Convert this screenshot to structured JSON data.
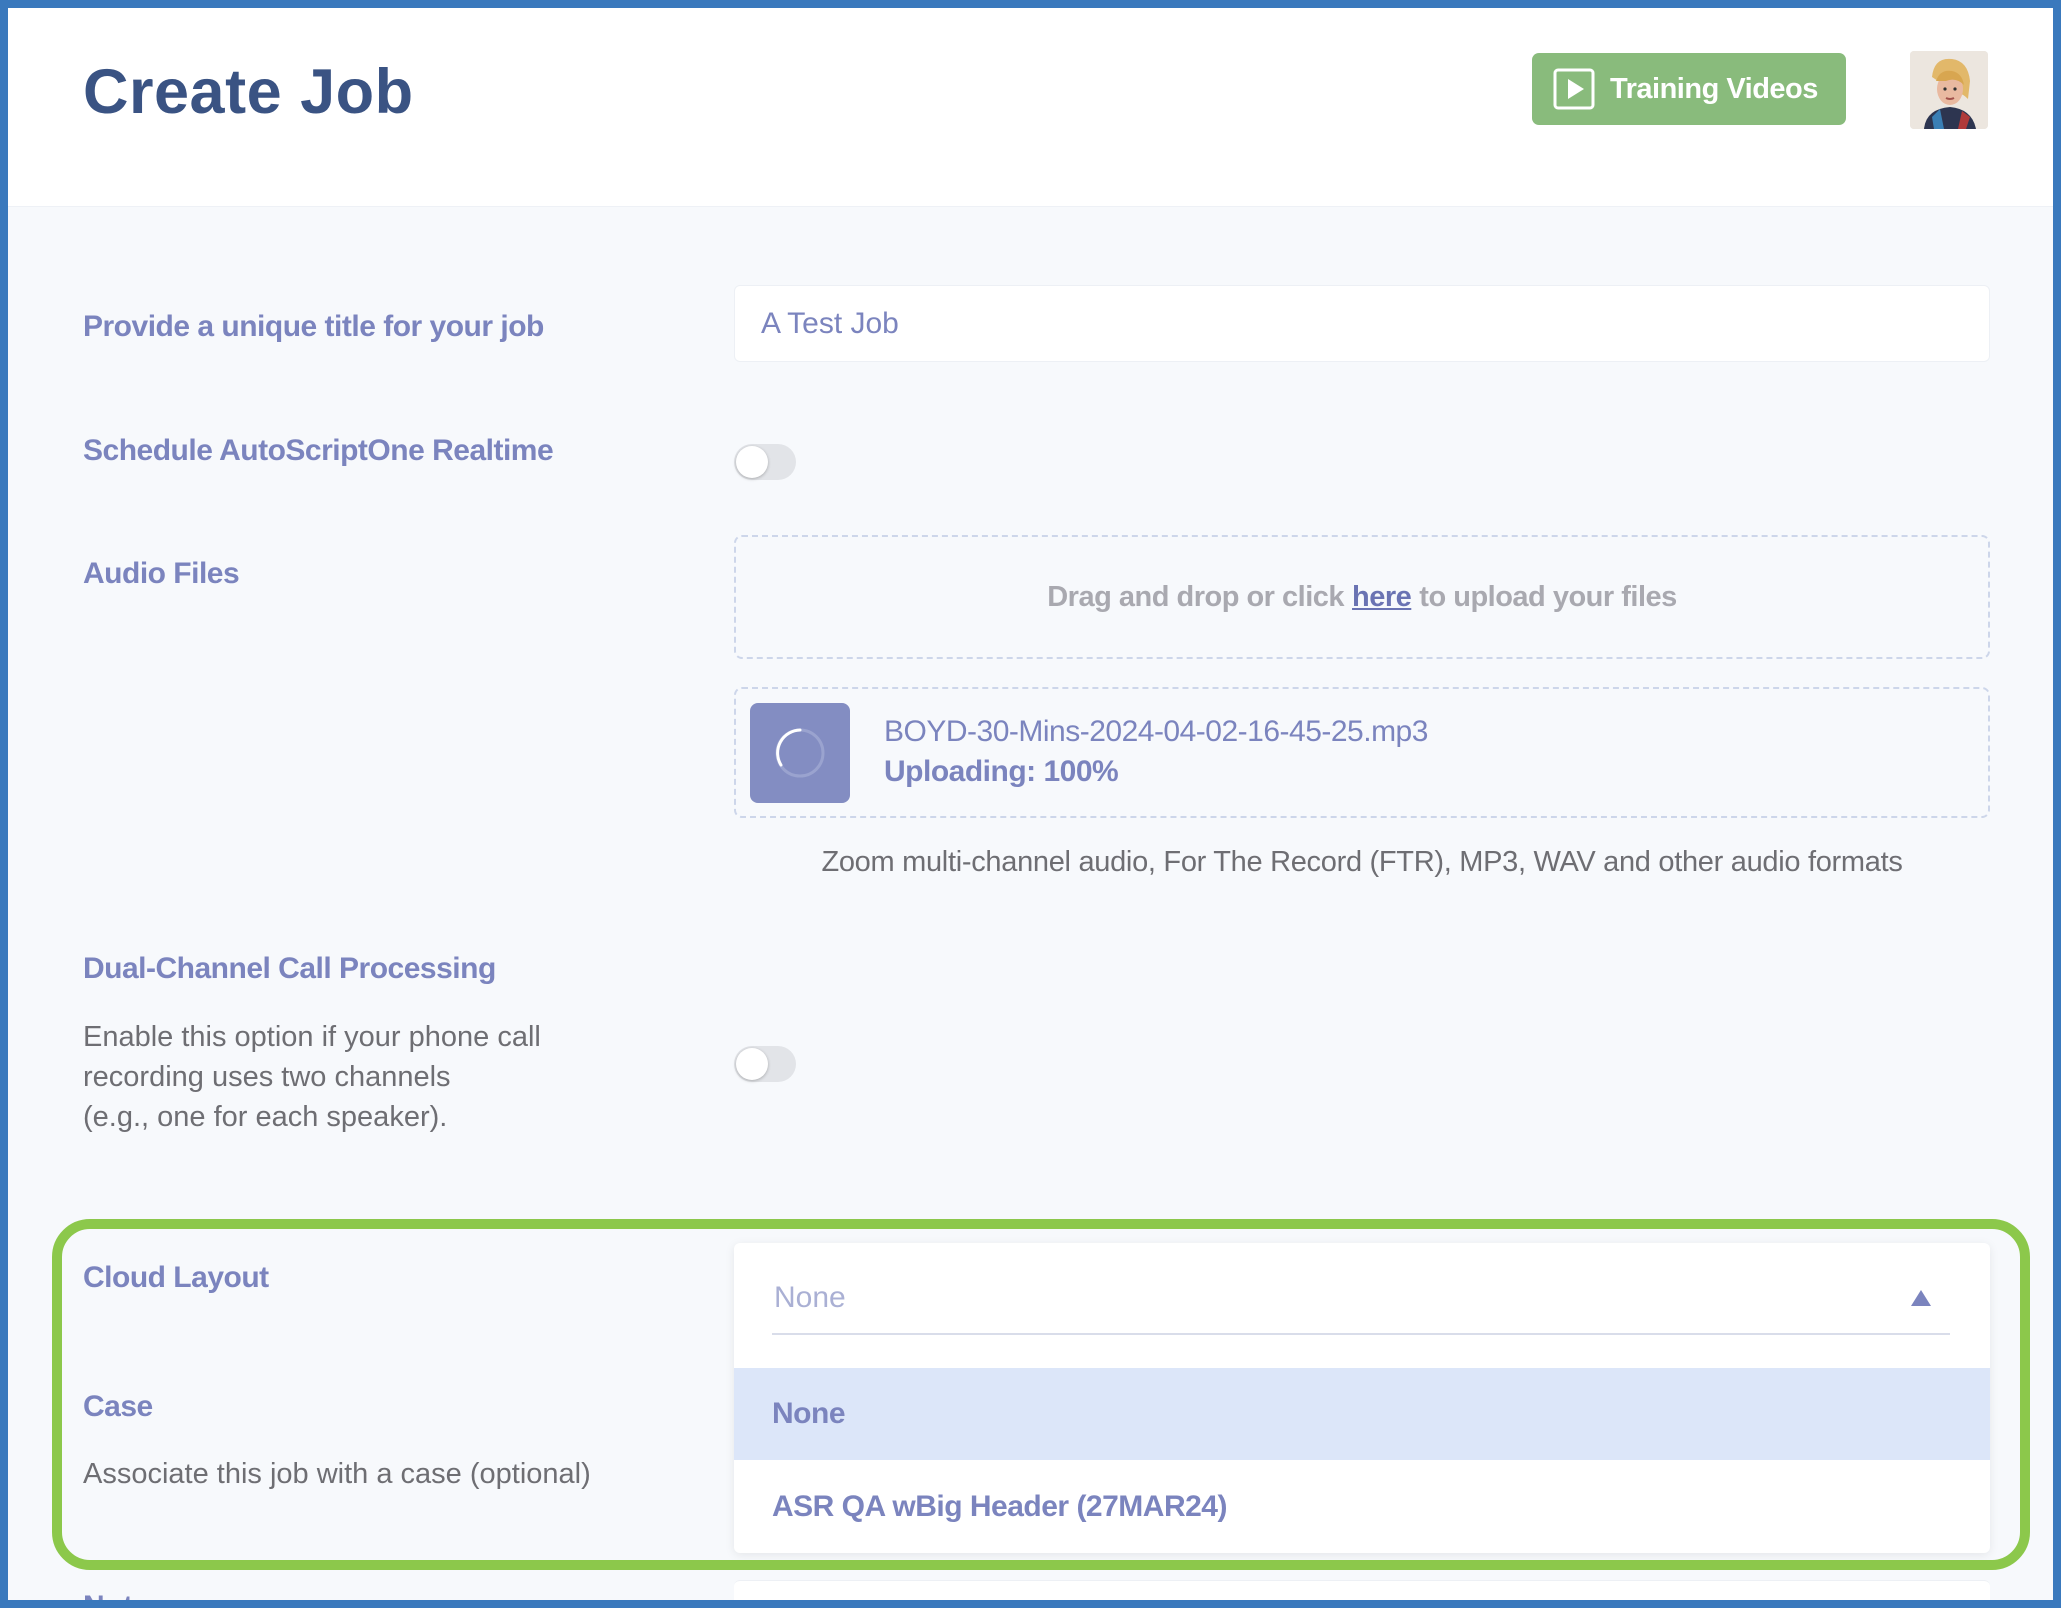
{
  "header": {
    "title": "Create Job",
    "training_label": "Training Videos",
    "training_color": "#89bb7c"
  },
  "form": {
    "title_label": "Provide a unique title for your job",
    "title_value": "A Test Job",
    "realtime_label": "Schedule AutoScriptOne Realtime",
    "realtime_on": false,
    "audio_label": "Audio Files",
    "dropzone": {
      "before": "Drag and drop or click",
      "link": "here",
      "after": "to upload your files"
    },
    "file": {
      "name": "BOYD-30-Mins-2024-04-02-16-45-25.mp3",
      "status": "Uploading: 100%",
      "progress": 1.0
    },
    "formats_note": "Zoom multi-channel audio, For The Record (FTR), MP3, WAV and other audio formats",
    "dual_label": "Dual-Channel Call Processing",
    "dual_desc": [
      "Enable this option if your phone call",
      "recording uses two channels",
      "(e.g., one for each speaker)."
    ],
    "dual_on": false,
    "cloud_layout_label": "Cloud Layout",
    "cloud_layout": {
      "placeholder": "None",
      "options": [
        "None",
        "ASR QA wBig Header (27MAR24)"
      ],
      "selected_index": 0
    },
    "case_label": "Case",
    "case_desc": "Associate this job with a case (optional)",
    "notes_label": "Notes"
  },
  "colors": {
    "frame": "#3a79bd",
    "highlight": "#8cc84b",
    "label": "#7b84be",
    "title": "#3a5383",
    "selected_option": "#dce6f9"
  },
  "icons": {
    "training": "play-icon",
    "avatar": "user-avatar",
    "file": "spinner-icon",
    "dropdown": "caret-up-icon"
  }
}
